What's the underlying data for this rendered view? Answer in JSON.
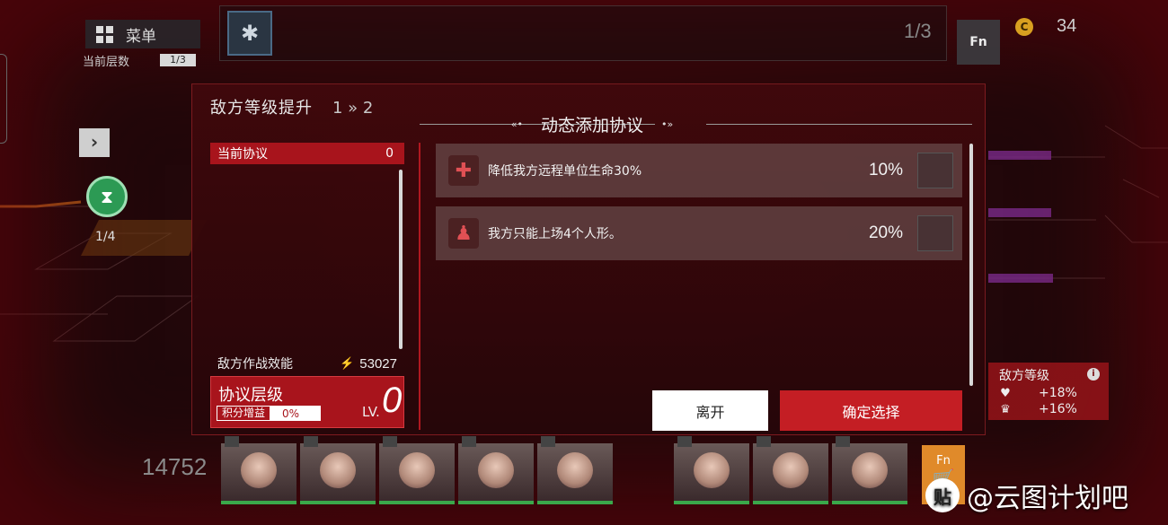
{
  "hud": {
    "menu_label": "菜单",
    "floor_label": "当前层数",
    "floor_value": "1/3",
    "top_count": "1/3",
    "fn_label": "Fn",
    "coin_symbol": "C",
    "coin_value": "34",
    "left_tab_glyph": "›",
    "node_count": "1/4",
    "left_score": "14752",
    "cart_label": "Fn"
  },
  "enemy_panel": {
    "title": "敌方等级",
    "info": "i",
    "stats": [
      {
        "icon": "heart-icon",
        "value": "+18%"
      },
      {
        "icon": "crown-icon",
        "value": "+16%"
      }
    ]
  },
  "modal": {
    "title": "敌方等级提升",
    "level_change": "1 » 2",
    "section_title": "动态添加协议",
    "arrow_left": "«•",
    "arrow_right": "•»",
    "current_protocol_label": "当前协议",
    "current_protocol_count": "0",
    "enemy_efficiency_label": "敌方作战效能",
    "enemy_efficiency_value": "53027",
    "protocol_level_label": "协议层级",
    "score_bonus_label": "积分增益",
    "score_bonus_value": "0%",
    "lv_label": "LV.",
    "lv_value": "0",
    "protocols": [
      {
        "icon": "health-down-icon",
        "text": "降低我方远程单位生命30%",
        "percent": "10%"
      },
      {
        "icon": "deploy-limit-icon",
        "text": "我方只能上场4个人形。",
        "percent": "20%"
      }
    ],
    "leave_label": "离开",
    "confirm_label": "确定选择"
  },
  "watermark": {
    "icon_text": "贴",
    "text": "@云图计划吧"
  },
  "colors": {
    "accent_red": "#c41e24",
    "panel_red": "#a8141c",
    "bg_dark": "#24070a"
  }
}
